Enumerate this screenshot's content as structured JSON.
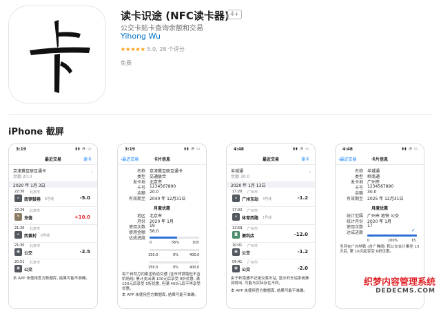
{
  "app": {
    "icon_char": "卡",
    "title": "读卡识途 (NFC读卡器)",
    "age_rating": "4+",
    "subtitle": "公交卡贴卡查询余额和交易",
    "developer": "Yihong Wu",
    "stars": "★★★★★",
    "rating_text": "5.0, 28 个评分",
    "price": "免费"
  },
  "section_title": "iPhone 截屏",
  "shots": [
    {
      "time": "3:19",
      "nav_title": "最近交易",
      "nav_right": "读卡",
      "card_name": "京津冀互联互通卡",
      "balance": "余额 20.0",
      "date_header": "2020 年 1月 3日",
      "txns": [
        {
          "time": "22:30",
          "city": "北京市",
          "place": "南锣鼓巷",
          "line": "6号线",
          "amount": "-5.0"
        },
        {
          "time": "22:29",
          "city": "北京市",
          "place": "充值",
          "line": "",
          "amount": "+10.0"
        },
        {
          "time": "21:30",
          "city": "北京市",
          "place": "西黄村",
          "line": "6号线",
          "amount": ""
        },
        {
          "time": "21:30",
          "city": "北京市",
          "place": "公交",
          "line": "",
          "amount": "-2.5"
        },
        {
          "time": "20:51",
          "city": "北京市",
          "place": "公交",
          "line": "",
          "amount": ""
        }
      ],
      "footnote": "本 APP 未使用官方数据库, 结果可能不准确。"
    },
    {
      "time": "3:19",
      "nav_back": "最近交易",
      "nav_title": "卡片信息",
      "fields": [
        {
          "label": "名称",
          "value": "京津冀互联互通卡"
        },
        {
          "label": "类型",
          "value": "交通联合"
        },
        {
          "label": "发卡地",
          "value": "北京市"
        },
        {
          "label": "卡号",
          "value": "1234567890"
        },
        {
          "label": "余额",
          "value": "20.0"
        },
        {
          "label": "有效期至",
          "value": "2040 年 12月31日"
        }
      ],
      "monthly_header": "月度优惠",
      "monthly": [
        {
          "label": "地区",
          "value": "北京市"
        },
        {
          "label": "月份",
          "value": "2020 年 1月"
        },
        {
          "label": "使用次数",
          "value": "19"
        },
        {
          "label": "使用金额",
          "value": "56.0"
        },
        {
          "label": "达成进度",
          "value": ""
        }
      ],
      "bar1_labels": [
        "0",
        "56%",
        "100"
      ],
      "bar1_fill": 0.56,
      "bar2_labels": [
        "150.0",
        "0%",
        "400.0"
      ],
      "bar2_fill": 0.0,
      "footnote": "每个自然月内乘坐轨道交通 (含市郊铁路但不含机场线) 累计支出满 100元后享受 8折优惠, 满150元后享受 5折优惠, 但满 400元后不再享受优惠。",
      "footnote2": "本 APP 未使用官方数据库, 结果可能不准确。"
    },
    {
      "time": "4:48",
      "nav_title": "最近交易",
      "nav_right": "读卡",
      "card_name": "羊城通",
      "balance": "余额 30.0",
      "date_header": "2020 年 1月 13日",
      "txns": [
        {
          "time": "17:20",
          "city": "广州市",
          "place": "广州东站",
          "line": "3号线",
          "amount": "-1.2"
        },
        {
          "time": "17:02",
          "city": "广州市",
          "place": "体育西路",
          "line": "1号线",
          "amount": ""
        },
        {
          "time": "13:59",
          "city": "广州市",
          "place": "便利店",
          "line": "",
          "amount": "-12.0"
        },
        {
          "time": "10:01",
          "city": "广州市",
          "place": "公交",
          "line": "",
          "amount": "-1.2"
        },
        {
          "time": "09:41",
          "city": "广州市",
          "place": "公交",
          "line": "",
          "amount": "-2.0"
        }
      ],
      "footnote": "由于岭南通不记录交易车站, 显示的车站系统推测得出, 可能与实际存在不同。",
      "footnote2": "本 APP 未使用官方数据库, 结果可能不准确。"
    },
    {
      "time": "4:48",
      "nav_back": "最近交易",
      "nav_title": "卡片信息",
      "fields": [
        {
          "label": "名称",
          "value": "羊城通"
        },
        {
          "label": "类型",
          "value": "岭南通"
        },
        {
          "label": "发卡地",
          "value": "广州市"
        },
        {
          "label": "卡号",
          "value": "1234567890"
        },
        {
          "label": "余额",
          "value": "30.0"
        },
        {
          "label": "有效期至",
          "value": "2025 年 12月31日"
        }
      ],
      "monthly_header": "月度优惠",
      "monthly": [
        {
          "label": "统计范围",
          "value": "广州市 地铁 公交"
        },
        {
          "label": "统计月份",
          "value": "2020 年 1月"
        },
        {
          "label": "使用次数",
          "value": "17"
        },
        {
          "label": "达成进度",
          "value": ""
        }
      ],
      "bar1_labels": [
        "0",
        "100%",
        "15"
      ],
      "bar1_fill": 1.0,
      "footnote": "当月在广州地铁 (含广佛线) 和公交合计乘坐 15 次后, 第 16次起享受 6折优惠。"
    }
  ],
  "watermark": {
    "line1": "织梦内容管理系统",
    "line2": "DEDECMS.COM"
  }
}
